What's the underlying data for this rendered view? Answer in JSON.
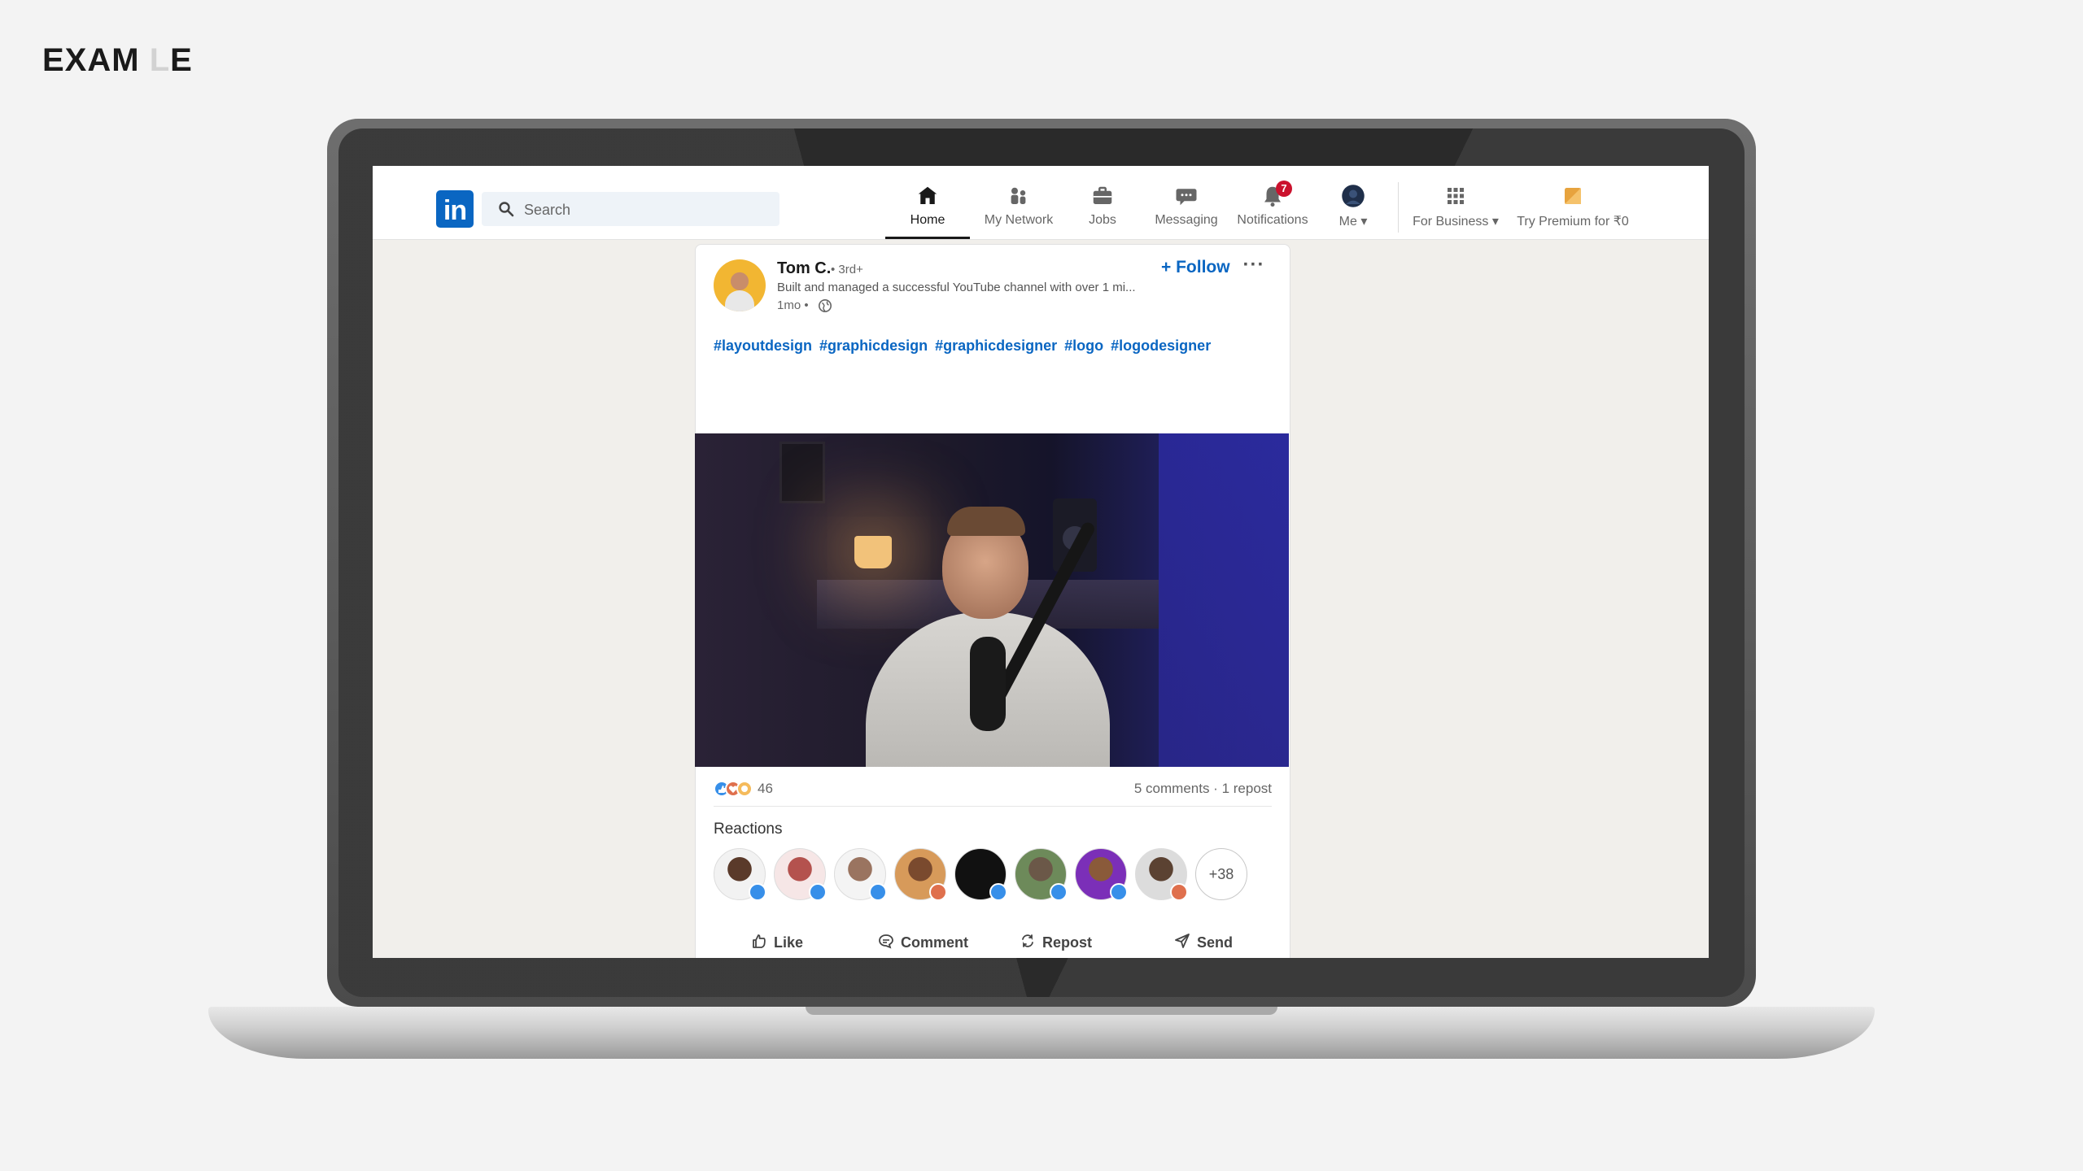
{
  "corner_label": {
    "main": "EXAM",
    "faded": "L",
    "end": "E"
  },
  "navbar": {
    "logo_text": "in",
    "search": {
      "placeholder": "Search",
      "value": ""
    },
    "items": [
      {
        "label": "Home",
        "icon": "home-icon",
        "active": true
      },
      {
        "label": "My Network",
        "icon": "people-icon"
      },
      {
        "label": "Jobs",
        "icon": "briefcase-icon"
      },
      {
        "label": "Messaging",
        "icon": "chat-icon"
      },
      {
        "label": "Notifications",
        "icon": "bell-icon",
        "badge": "7"
      },
      {
        "label": "Me",
        "icon": "avatar"
      },
      {
        "label": "For Business",
        "icon": "grid-icon"
      },
      {
        "label": "Try Premium for ₹0",
        "icon": "premium-icon"
      }
    ]
  },
  "post": {
    "author": {
      "name": "Tom C.",
      "degree": "• 3rd+",
      "headline": "Built and managed a successful YouTube channel with over 1 mi...",
      "time": "1mo •"
    },
    "follow_label": "Follow",
    "more_label": "···",
    "hashtags": [
      "#layoutdesign",
      "#graphicdesign",
      "#graphicdesigner",
      "#logo",
      "#logodesigner"
    ],
    "reaction_count": "46",
    "comments_reposts": "5 comments · 1 repost",
    "reactions_title": "Reactions",
    "more_reactors": "+38",
    "actions": [
      "Like",
      "Comment",
      "Repost",
      "Send"
    ]
  },
  "colors": {
    "brand": "#0a66c2",
    "badge": "#cb112d",
    "screen_bg": "#f1efeb"
  }
}
